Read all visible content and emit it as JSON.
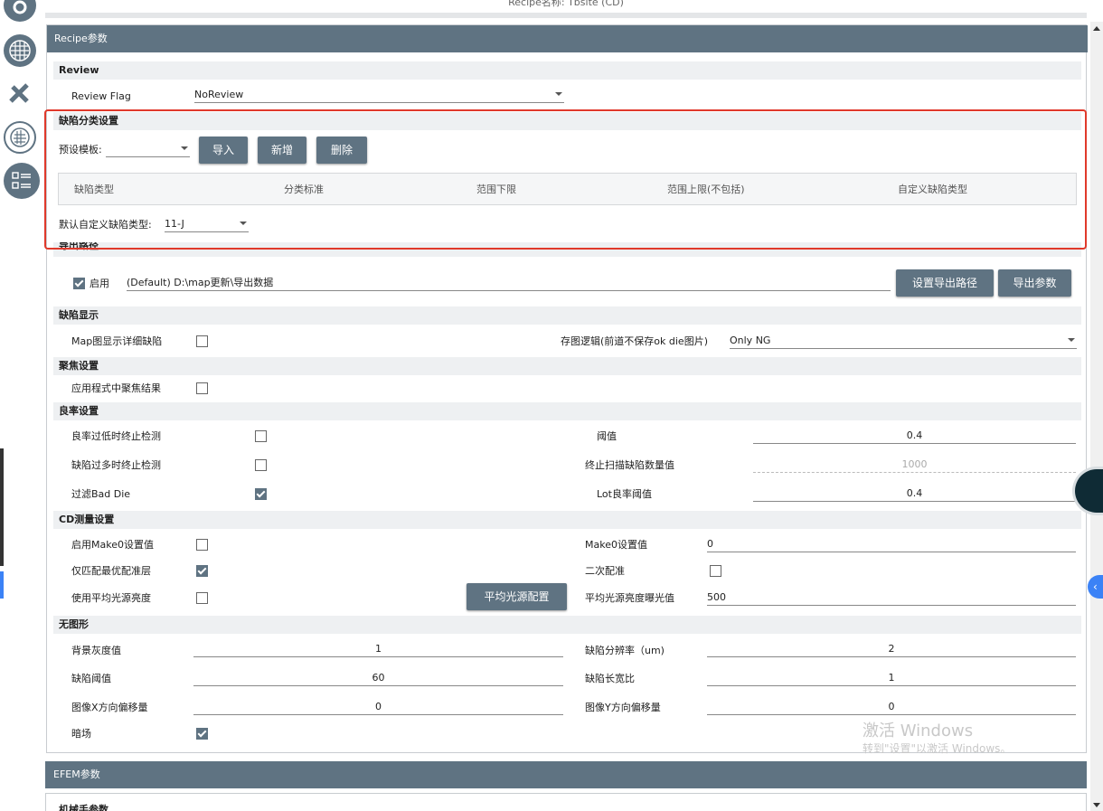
{
  "window": {
    "title": "Recipe名称: Tbsite (CD)"
  },
  "recipe_panel": {
    "title": "Recipe参数",
    "review": {
      "section": "Review",
      "flag_label": "Review Flag",
      "flag_value": "NoReview"
    },
    "defect_classification": {
      "section": "缺陷分类设置",
      "template_label": "预设模板:",
      "template_value": "",
      "buttons": {
        "import": "导入",
        "add": "新增",
        "delete": "删除"
      },
      "table_headers": [
        "缺陷类型",
        "分类标准",
        "范围下限",
        "范围上限(不包括)",
        "自定义缺陷类型"
      ],
      "default_type_label": "默认自定义缺陷类型:",
      "default_type_value": "11-J"
    },
    "export_path": {
      "section": "导出路径",
      "enable_label": "启用",
      "enabled": true,
      "path_value": "(Default) D:\\map更新\\导出数据",
      "set_path_button": "设置导出路径",
      "export_params_button": "导出参数"
    },
    "defect_display": {
      "section": "缺陷显示",
      "map_detail_label": "Map图显示详细缺陷",
      "map_detail_checked": false,
      "save_logic_label": "存图逻辑(前道不保存ok die图片)",
      "save_logic_value": "Only NG"
    },
    "focus": {
      "section": "聚焦设置",
      "apply_label": "应用程式中聚焦结果",
      "apply_checked": false
    },
    "yield": {
      "section": "良率设置",
      "low_yield_stop_label": "良率过低时终止检测",
      "low_yield_stop_checked": false,
      "too_many_defects_label": "缺陷过多时终止检测",
      "too_many_defects_checked": false,
      "filter_bad_die_label": "过滤Bad Die",
      "filter_bad_die_checked": true,
      "threshold_label": "阈值",
      "threshold_value": "0.4",
      "stop_scan_count_label": "终止扫描缺陷数量值",
      "stop_scan_count_value": "1000",
      "lot_yield_threshold_label": "Lot良率阈值",
      "lot_yield_threshold_value": "0.4"
    },
    "cd_measure": {
      "section": "CD测量设置",
      "enable_make0_label": "启用Make0设置值",
      "enable_make0_checked": false,
      "make0_value_label": "Make0设置值",
      "make0_value": "0",
      "best_layer_label": "仅匹配最优配准层",
      "best_layer_checked": true,
      "secondary_label": "二次配准",
      "secondary_checked": false,
      "avg_brightness_label": "使用平均光源亮度",
      "avg_brightness_checked": false,
      "avg_light_button": "平均光源配置",
      "avg_exposure_label": "平均光源亮度曝光值",
      "avg_exposure_value": "500"
    },
    "no_pattern": {
      "section": "无图形",
      "bg_gray_label": "背景灰度值",
      "bg_gray_value": "1",
      "defect_res_label": "缺陷分辨率（um)",
      "defect_res_value": "2",
      "defect_threshold_label": "缺陷阈值",
      "defect_threshold_value": "60",
      "defect_aspect_label": "缺陷长宽比",
      "defect_aspect_value": "1",
      "x_offset_label": "图像X方向偏移量",
      "x_offset_value": "0",
      "y_offset_label": "图像Y方向偏移量",
      "y_offset_value": "0",
      "darkfield_label": "暗场",
      "darkfield_checked": true
    }
  },
  "efem_panel": {
    "title": "EFEM参数",
    "sub_section": "机械手参数"
  },
  "watermark": {
    "line1": "激活 Windows",
    "line2": "转到\"设置\"以激活 Windows。"
  },
  "sidebar_icons": [
    "settings-icon",
    "wafer-grid-icon",
    "tools-icon",
    "wafer-map-icon",
    "checklist-icon"
  ],
  "colors": {
    "accent": "#5f7382",
    "highlight_box": "#e0392b",
    "section_bg": "#eef0f2"
  }
}
